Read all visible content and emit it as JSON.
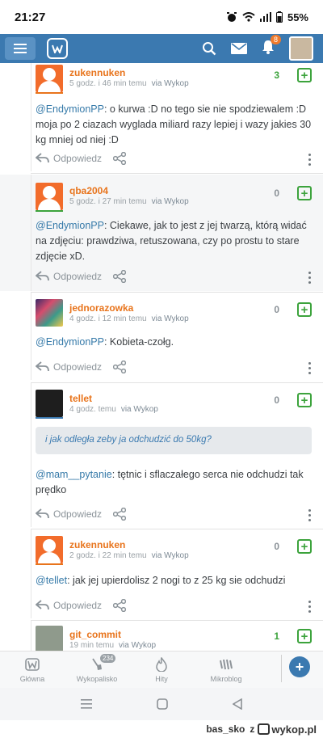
{
  "status_bar": {
    "time": "21:27",
    "battery": "55%",
    "icons": [
      "alarm-icon",
      "wifi-icon",
      "signal-icon",
      "battery-icon"
    ]
  },
  "app_bar": {
    "icons": [
      "hamburger-icon",
      "wykop-logo",
      "search-icon",
      "mail-icon",
      "bell-icon"
    ],
    "notification_count": "8"
  },
  "comments": [
    {
      "username": "zukennuken",
      "time": "5 godz. i 46 min temu",
      "via": "via Wykop",
      "votes": "3",
      "mention": "@EndymionPP",
      "text": ": o kurwa :D no tego sie nie spodziewalem :D moja po 2 ciazach wyglada miliard razy lepiej i wazy jakies 30 kg mniej od niej :D",
      "reply": "Odpowiedz"
    },
    {
      "username": "qba2004",
      "time": "5 godz. i 27 min temu",
      "via": "via Wykop",
      "votes": "0",
      "mention": "@EndymionPP",
      "text": ": Ciekawe, jak to jest z jej twarzą, którą widać na zdjęciu: prawdziwa, retuszowana, czy po prostu to stare zdjęcie xD.",
      "reply": "Odpowiedz"
    },
    {
      "username": "jednorazowka",
      "time": "4 godz. i 12 min temu",
      "via": "via Wykop",
      "votes": "0",
      "mention": "@EndymionPP",
      "text": ": Kobieta-czołg.",
      "reply": "Odpowiedz"
    },
    {
      "username": "tellet",
      "time": "4 godz. temu",
      "via": "via Wykop",
      "votes": "0",
      "quote": "i jak odległa zeby ja odchudzić do 50kg?",
      "mention": "@mam__pytanie",
      "text": ": tętnic i sflaczałego serca nie odchudzi tak prędko",
      "reply": "Odpowiedz"
    },
    {
      "username": "zukennuken",
      "time": "2 godz. i 22 min temu",
      "via": "via Wykop",
      "votes": "0",
      "mention": "@tellet",
      "text": ": jak jej upierdolisz 2 nogi to z 25 kg sie odchudzi",
      "reply": "Odpowiedz"
    },
    {
      "username": "git_commit",
      "time": "19 min temu",
      "via": "via Wykop",
      "votes": "1"
    }
  ],
  "bottom_nav": {
    "items": [
      {
        "label": "Główna"
      },
      {
        "label": "Wykopalisko",
        "badge": "234"
      },
      {
        "label": "Hity"
      },
      {
        "label": "Mikroblog"
      }
    ]
  },
  "watermark": {
    "author": "bas_sko",
    "z": "z",
    "site": "wykop.pl"
  },
  "colors": {
    "accent": "#3b79b0",
    "username": "#e8741c",
    "mention": "#367aa9",
    "upvote": "#3ca33c"
  }
}
